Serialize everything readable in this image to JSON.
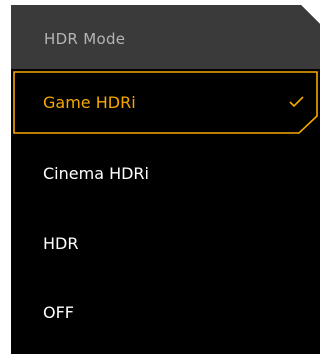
{
  "menu": {
    "title": "HDR Mode",
    "options": [
      {
        "label": "Game HDRi",
        "selected": true
      },
      {
        "label": "Cinema HDRi",
        "selected": false
      },
      {
        "label": "HDR",
        "selected": false
      },
      {
        "label": "OFF",
        "selected": false
      }
    ]
  },
  "icons": {
    "selected_marker": "check-icon"
  },
  "colors": {
    "background": "#000000",
    "header_background": "#3a3a3a",
    "header_text": "#b4b4b4",
    "option_text": "#ffffff",
    "accent": "#f5a800"
  }
}
